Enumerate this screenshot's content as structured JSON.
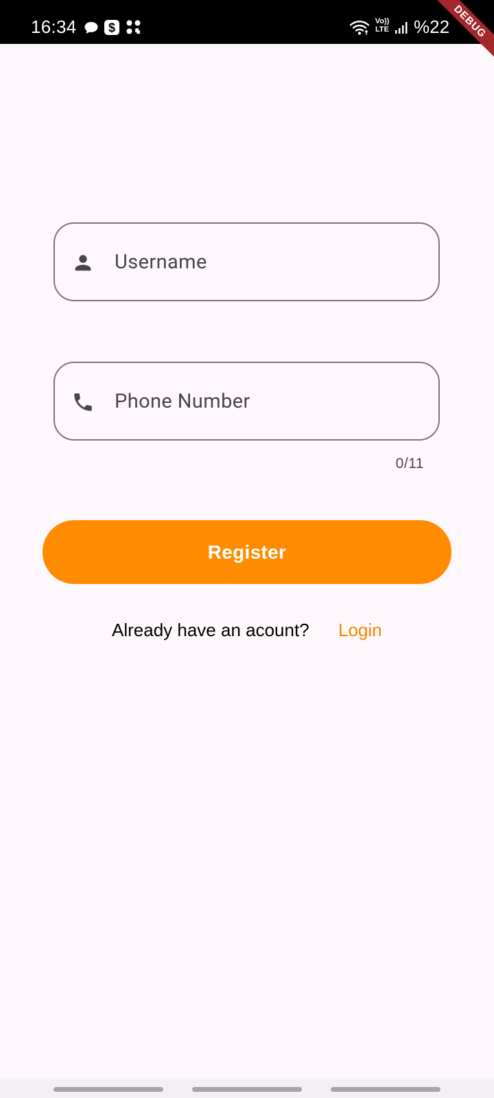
{
  "status_bar": {
    "time": "16:34",
    "battery": "%22",
    "icons": [
      "chat-bubble-icon",
      "dollar-app-icon",
      "dots-grid-icon",
      "wifi-icon",
      "volte-icon",
      "signal-icon"
    ],
    "volte_label_top": "Vo))",
    "volte_label_bottom": "LTE"
  },
  "debug_banner": "DEBUG",
  "form": {
    "username": {
      "placeholder": "Username",
      "value": "",
      "icon": "person-icon"
    },
    "phone": {
      "placeholder": "Phone Number",
      "value": "",
      "icon": "phone-icon",
      "counter": "0/11"
    },
    "register_label": "Register",
    "login_prompt": "Already have an acount?",
    "login_label": "Login"
  },
  "colors": {
    "accent": "#FF8C00",
    "link": "#F08A00",
    "background": "#FEF7FB",
    "field_border": "#7B767E",
    "icon": "#49454F"
  }
}
